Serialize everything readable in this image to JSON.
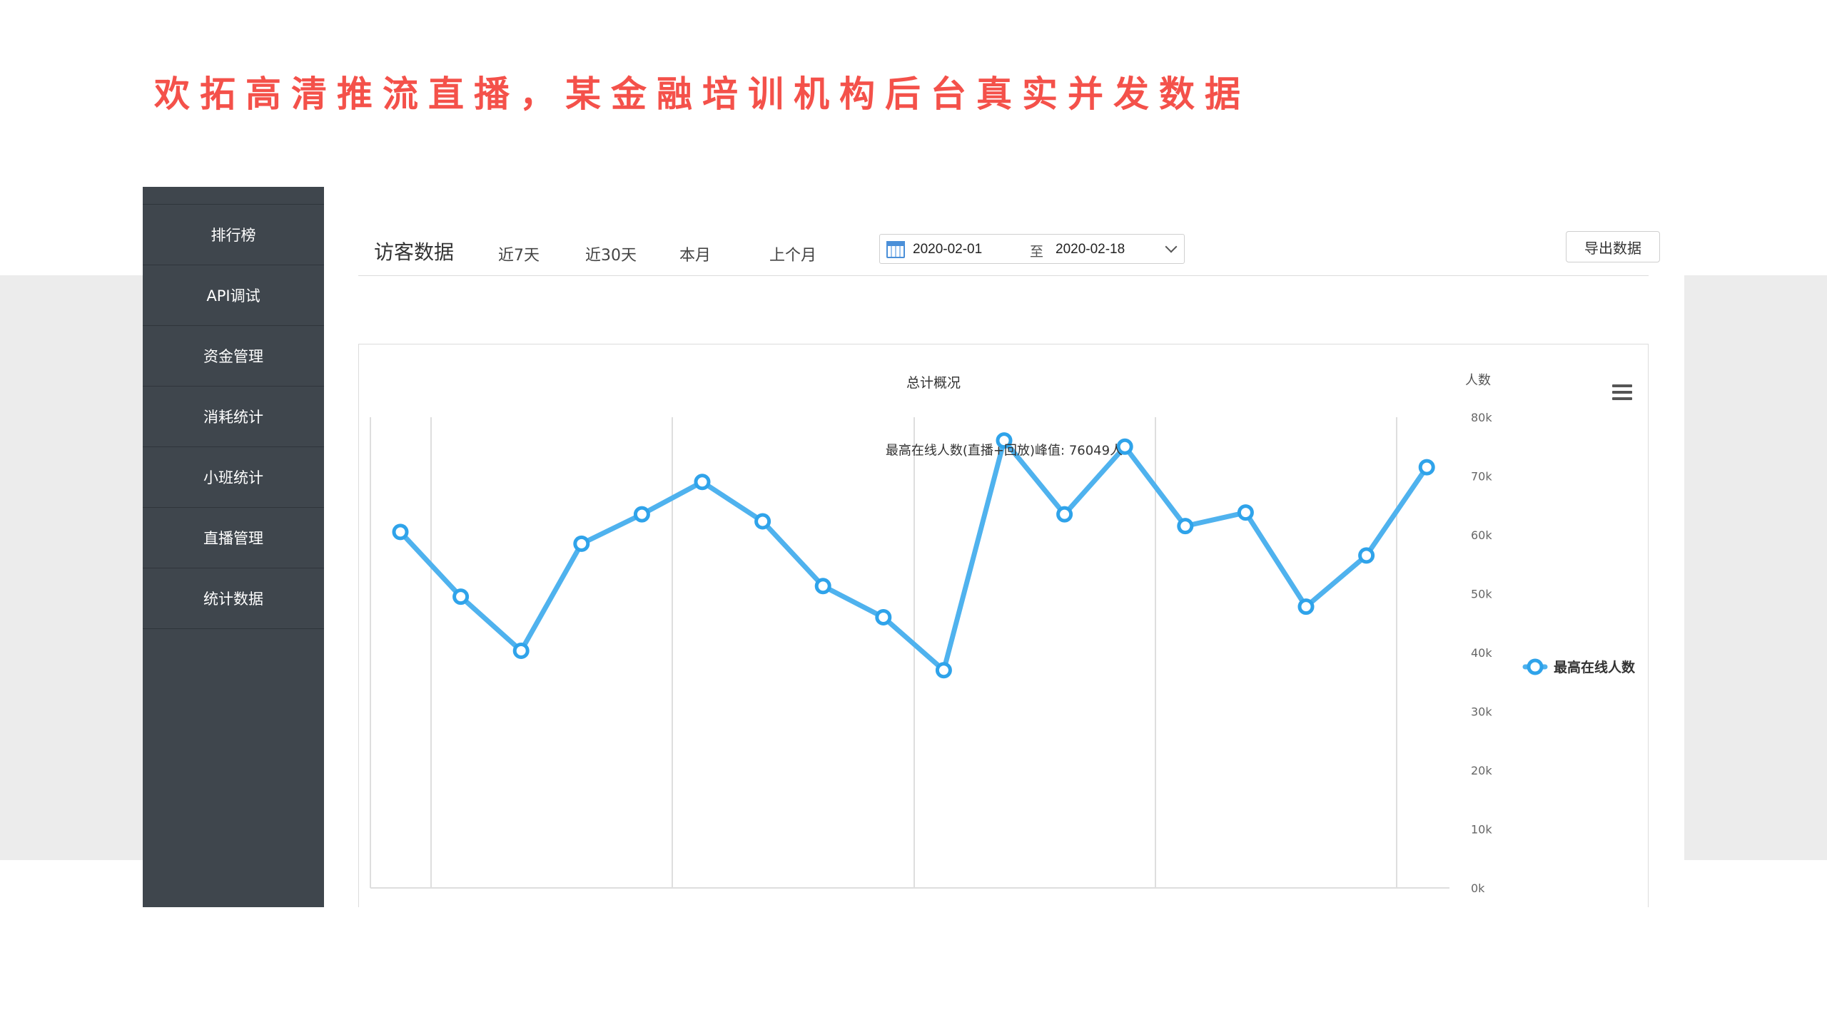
{
  "slide": {
    "title": "欢拓高清推流直播，某金融培训机构后台真实并发数据"
  },
  "sidebar": {
    "items": [
      {
        "label": "排行榜"
      },
      {
        "label": "API调试"
      },
      {
        "label": "资金管理"
      },
      {
        "label": "消耗统计"
      },
      {
        "label": "小班统计"
      },
      {
        "label": "直播管理"
      },
      {
        "label": "统计数据"
      }
    ]
  },
  "toolbar": {
    "title": "访客数据",
    "tabs": [
      {
        "label": "近7天"
      },
      {
        "label": "近30天"
      },
      {
        "label": "本月"
      },
      {
        "label": "上个月"
      }
    ],
    "date_start": "2020-02-01",
    "date_separator": "至",
    "date_end": "2020-02-18",
    "export_label": "导出数据"
  },
  "icons": {
    "calendar": "calendar-icon",
    "dropdown": "chevron-down-icon",
    "menu": "hamburger-menu-icon"
  },
  "chart_data": {
    "type": "line",
    "title": "总计概况",
    "ylabel": "人数",
    "ylim": [
      0,
      80000
    ],
    "yticks": [
      "0k",
      "10k",
      "20k",
      "30k",
      "40k",
      "50k",
      "60k",
      "70k",
      "80k"
    ],
    "grid": "vertical",
    "legend_position": "right",
    "series": [
      {
        "name": "最高在线人数",
        "color": "#4fb2ee",
        "values": [
          60500,
          49500,
          40300,
          58500,
          63500,
          69000,
          62300,
          51300,
          46000,
          37000,
          76049,
          63500,
          75000,
          61500,
          63800,
          47800,
          56500,
          71500
        ]
      }
    ],
    "annotation": {
      "text": "最高在线人数(直播+回放)峰值: 76049人",
      "point_index": 10
    }
  }
}
